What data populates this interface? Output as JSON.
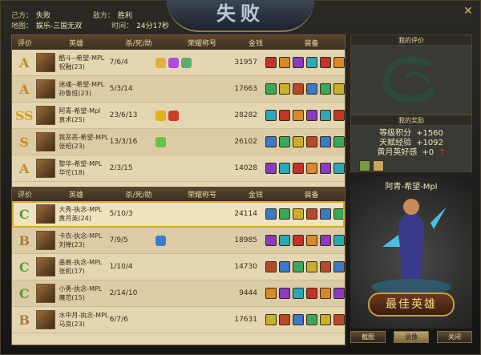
{
  "header": {
    "own_label": "己方：",
    "own_result": "失败",
    "enemy_label": "敌方：",
    "enemy_result": "胜利",
    "map_label": "地图：",
    "map_name": "娱乐-三国无双",
    "time_label": "时间：",
    "time_value": "24分17秒",
    "logo_text": "失败",
    "close_icon": "close-icon"
  },
  "table": {
    "headers": [
      "评价",
      "英雄",
      "杀/死/助",
      "荣耀称号",
      "金钱",
      "装备"
    ]
  },
  "team1": [
    {
      "rank": "A",
      "rank_color": "#c08a2a",
      "player": "酷斗--希望-MPL",
      "hero": "祝融(23)",
      "kda": "7/6/4",
      "gold": "31957",
      "honors": [
        "#e0b040",
        "#b04ae0",
        "#5ab070"
      ]
    },
    {
      "rank": "A",
      "rank_color": "#c08a2a",
      "player": "迷魂--希望-MPL",
      "hero": "孙鲁班(23)",
      "kda": "5/3/14",
      "gold": "17663",
      "honors": []
    },
    {
      "rank": "SS",
      "rank_color": "#d8a21a",
      "player": "阿青-希望-Mpl",
      "hero": "袁术(25)",
      "kda": "23/6/13",
      "gold": "28282",
      "honors": [
        "#e3b21a",
        "#d03a2a"
      ]
    },
    {
      "rank": "S",
      "rank_color": "#d08a1a",
      "player": "我恶恶-希望-MPL",
      "hero": "张昭(23)",
      "kda": "13/3/16",
      "gold": "26102",
      "honors": [
        "#6ac04a"
      ]
    },
    {
      "rank": "A",
      "rank_color": "#c08a2a",
      "player": "黎华-希望-MPL",
      "hero": "华佗(18)",
      "kda": "2/3/15",
      "gold": "14028",
      "honors": []
    }
  ],
  "team2": [
    {
      "rank": "C",
      "rank_color": "#5a9a3a",
      "player": "大秀-执念-MPL",
      "hero": "黄月英(24)",
      "kda": "5/10/3",
      "gold": "24114",
      "honors": [],
      "me": true
    },
    {
      "rank": "B",
      "rank_color": "#b07a3a",
      "player": "卡衣-执念-MPL",
      "hero": "刘禅(23)",
      "kda": "7/9/5",
      "gold": "18985",
      "honors": [
        "#3a7ad0"
      ]
    },
    {
      "rank": "C",
      "rank_color": "#5a9a3a",
      "player": "墨痕-执念-MPL",
      "hero": "张机(17)",
      "kda": "1/10/4",
      "gold": "14730",
      "honors": []
    },
    {
      "rank": "C",
      "rank_color": "#5a9a3a",
      "player": "小勇-执念-MPL",
      "hero": "魔范(15)",
      "kda": "2/14/10",
      "gold": "9444",
      "honors": []
    },
    {
      "rank": "B",
      "rank_color": "#b07a3a",
      "player": "水中月-执念-MPL",
      "hero": "马良(23)",
      "kda": "6/7/6",
      "gold": "17631",
      "honors": []
    }
  ],
  "items_palette": [
    "#c2342a",
    "#3a78c8",
    "#d88a2a",
    "#3aa85a",
    "#8a3ac0",
    "#c8b02a",
    "#2aa8b8",
    "#b8482a"
  ],
  "right": {
    "eval_title": "我的评价",
    "reward_title": "我的奖励",
    "rewards": [
      {
        "label": "等级积分",
        "value": "+1560"
      },
      {
        "label": "天赋经验",
        "value": "+1092"
      },
      {
        "label": "黄月英好感",
        "value": "+0"
      }
    ],
    "reward_up": "↑",
    "hero_name": "阿青-希望-Mpl",
    "best_hero_label": "最佳英雄",
    "buttons": [
      "截图",
      "录像",
      "关闭"
    ]
  }
}
